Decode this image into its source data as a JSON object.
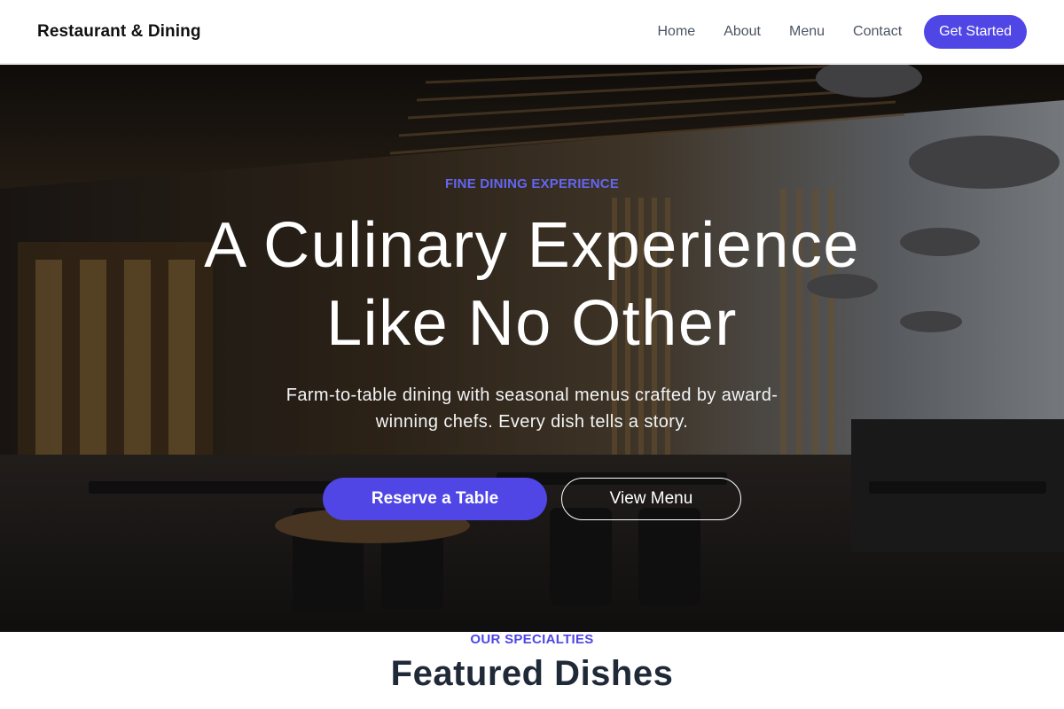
{
  "colors": {
    "accent": "#4f46e5",
    "eyebrow": "#4f46e5",
    "hero_eyebrow": "#6366f1"
  },
  "header": {
    "brand": "Restaurant & Dining",
    "nav": [
      {
        "label": "Home"
      },
      {
        "label": "About"
      },
      {
        "label": "Menu"
      },
      {
        "label": "Contact"
      }
    ],
    "cta_label": "Get Started"
  },
  "hero": {
    "eyebrow": "FINE DINING EXPERIENCE",
    "title_line1": "A Culinary Experience",
    "title_line2": "Like No Other",
    "subtitle": "Farm-to-table dining with seasonal menus crafted by award-winning chefs. Every dish tells a story.",
    "primary_button": "Reserve a Table",
    "secondary_button": "View Menu"
  },
  "section": {
    "eyebrow": "OUR SPECIALTIES",
    "title": "Featured Dishes"
  }
}
